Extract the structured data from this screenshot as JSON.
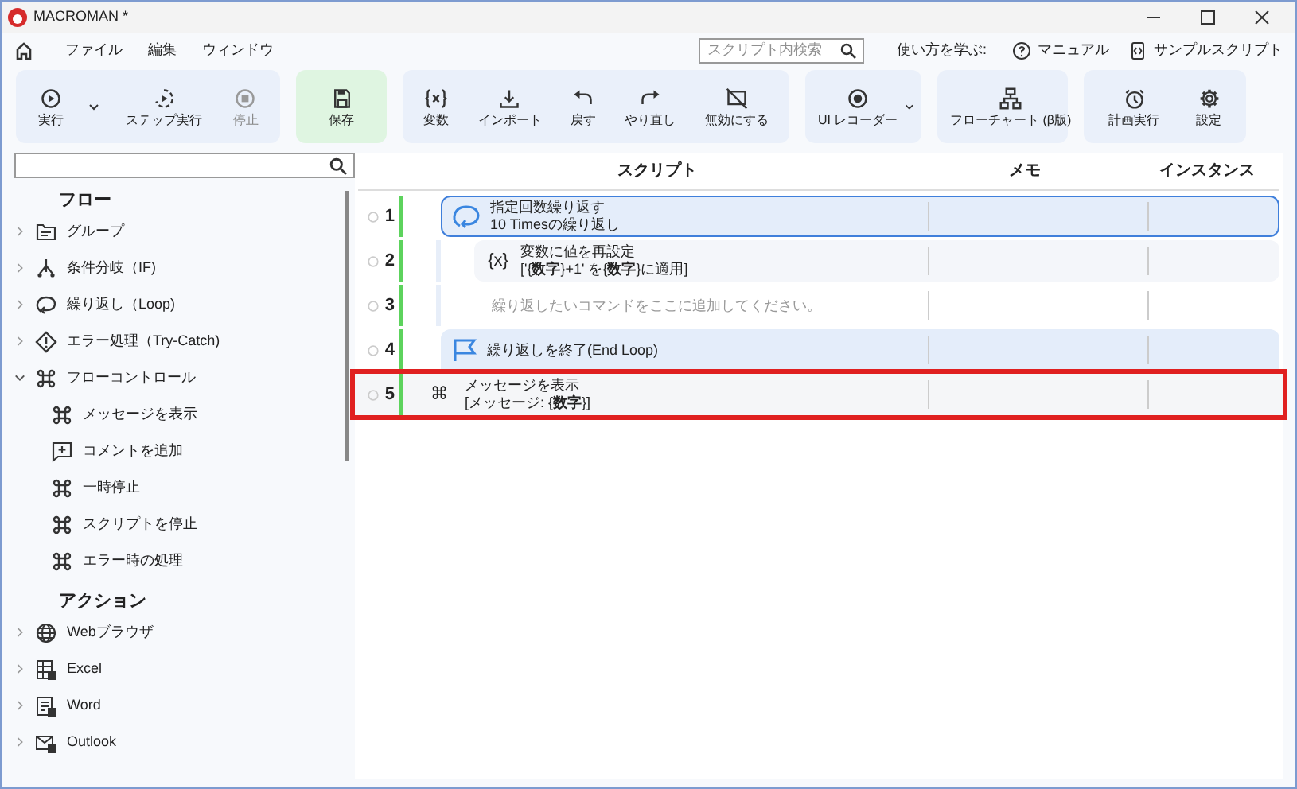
{
  "window": {
    "title": "MACROMAN *"
  },
  "menu": [
    "ファイル",
    "編集",
    "ウィンドウ"
  ],
  "search": {
    "placeholder": "スクリプト内検索"
  },
  "help": {
    "label": "使い方を学ぶ:",
    "links": [
      "マニュアル",
      "サンプルスクリプト"
    ]
  },
  "toolbar": {
    "groups": [
      {
        "kind": "plain",
        "items": [
          {
            "label": "実行",
            "disabled": false
          },
          {
            "label": "ステップ実行",
            "disabled": false
          },
          {
            "label": "停止",
            "disabled": true
          }
        ]
      },
      {
        "kind": "green",
        "items": [
          {
            "label": "保存",
            "disabled": false
          }
        ]
      },
      {
        "kind": "plain",
        "items": [
          {
            "label": "変数",
            "disabled": false
          },
          {
            "label": "インポート",
            "disabled": false
          },
          {
            "label": "戻す",
            "disabled": false
          },
          {
            "label": "やり直し",
            "disabled": false
          },
          {
            "label": "無効にする",
            "disabled": false
          }
        ]
      },
      {
        "kind": "plain",
        "items": [
          {
            "label": "UI レコーダー",
            "disabled": false
          }
        ]
      },
      {
        "kind": "plain",
        "items": [
          {
            "label": "フローチャート (β版)",
            "disabled": false
          }
        ]
      },
      {
        "kind": "plain",
        "items": [
          {
            "label": "計画実行",
            "disabled": false
          },
          {
            "label": "設定",
            "disabled": false
          }
        ]
      }
    ]
  },
  "sidebar": {
    "sections": [
      {
        "title": "フロー",
        "items": [
          {
            "label": "グループ",
            "expanded": false
          },
          {
            "label": "条件分岐（IF)",
            "expanded": false
          },
          {
            "label": "繰り返し（Loop)",
            "expanded": false
          },
          {
            "label": "エラー処理（Try-Catch)",
            "expanded": false
          },
          {
            "label": "フローコントロール",
            "expanded": true,
            "children": [
              {
                "label": "メッセージを表示"
              },
              {
                "label": "コメントを追加"
              },
              {
                "label": "一時停止"
              },
              {
                "label": "スクリプトを停止"
              },
              {
                "label": "エラー時の処理"
              }
            ]
          }
        ]
      },
      {
        "title": "アクション",
        "items": [
          {
            "label": "Webブラウザ",
            "expanded": false
          },
          {
            "label": "Excel",
            "expanded": false
          },
          {
            "label": "Word",
            "expanded": false
          },
          {
            "label": "Outlook",
            "expanded": false
          }
        ]
      }
    ]
  },
  "script": {
    "columns": [
      "スクリプト",
      "メモ",
      "インスタンス"
    ],
    "rows": [
      {
        "number": "1",
        "kind": "loop-start",
        "title": "指定回数繰り返す",
        "detail": "10 Timesの繰り返し",
        "selected": true,
        "highlighted": false,
        "children": [
          {
            "number": "2",
            "kind": "variable",
            "glyph": "{x}",
            "title": "変数に値を再設定",
            "detail": "['{**数字**}+1' を{**数字**}に適用]",
            "selected": false,
            "highlighted": false
          },
          {
            "number": "3",
            "kind": "placeholder",
            "title": "繰り返したいコマンドをここに追加してください。",
            "selected": false,
            "highlighted": false
          }
        ]
      },
      {
        "number": "4",
        "kind": "loop-end",
        "title": "繰り返しを終了(End Loop)",
        "selected": false,
        "highlighted": false
      },
      {
        "number": "5",
        "kind": "command",
        "glyph": "⌘",
        "title": "メッセージを表示",
        "detail": "[メッセージ: {**数字**}]",
        "selected": false,
        "highlighted": true
      }
    ]
  }
}
